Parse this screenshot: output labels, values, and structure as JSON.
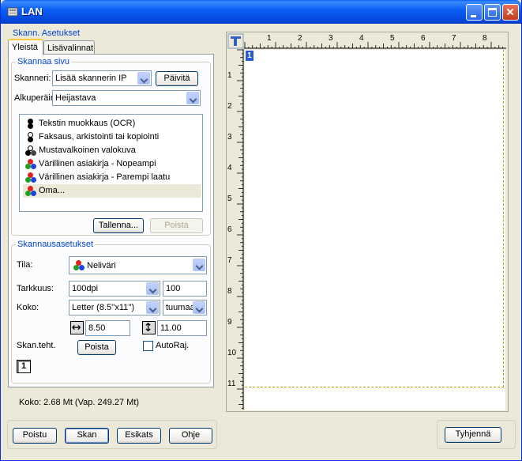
{
  "window": {
    "title": "LAN"
  },
  "settings_group": {
    "legend": "Skann. Asetukset"
  },
  "tabs": [
    {
      "label": "Yleistä"
    },
    {
      "label": "Lisävalinnat"
    }
  ],
  "scan_page": {
    "legend": "Skannaa sivu",
    "scanner_label": "Skanneri:",
    "scanner_value": "Lisää skannerin IP",
    "refresh_button": "Päivitä",
    "source_label": "Alkuperäin",
    "source_value": "Heijastava",
    "presets": [
      {
        "label": "Tekstin muokkaus (OCR)",
        "icon": "bw-dots-icon"
      },
      {
        "label": "Faksaus, arkistointi tai kopiointi",
        "icon": "bw-dots-icon"
      },
      {
        "label": "Mustavalkoinen valokuva",
        "icon": "gray-dots-icon"
      },
      {
        "label": "Värillinen asiakirja - Nopeampi",
        "icon": "color-dots-icon"
      },
      {
        "label": "Värillinen asiakirja - Parempi laatu",
        "icon": "color-dots-icon"
      },
      {
        "label": "Oma...",
        "icon": "color-dots-icon",
        "selected": true
      }
    ],
    "save_button": "Tallenna...",
    "delete_button": "Poista"
  },
  "scan_settings": {
    "legend": "Skannausasetukset",
    "mode_label": "Tila:",
    "mode_value": "Neliväri",
    "resolution_label": "Tarkkuus:",
    "resolution_value": "100dpi",
    "resolution_number": "100",
    "size_label": "Koko:",
    "size_value": "Letter (8.5''x11'')",
    "unit_value": "tuumaa",
    "width_value": "8.50",
    "height_value": "11.00",
    "scan_area_label": "Skan.teht.",
    "scan_area_delete": "Poista",
    "autocrop_label": "AutoRaj.",
    "page_count": "1"
  },
  "status": {
    "size_text": "Koko: 2.68 Mt (Vap. 249.27 Mt)"
  },
  "bottom_buttons": {
    "exit": "Poistu",
    "scan": "Skan",
    "preview": "Esikats",
    "help": "Ohje",
    "clear": "Tyhjennä"
  },
  "preview": {
    "page_marker": "1",
    "ruler_top": [
      "1",
      "2",
      "3",
      "4",
      "5",
      "6",
      "7",
      "8"
    ],
    "ruler_left": [
      "1",
      "2",
      "3",
      "4",
      "5",
      "6",
      "7",
      "8",
      "9",
      "10",
      "11"
    ]
  },
  "colors": {
    "title_bar": "#0a5ff7",
    "accent_label": "#0046d5",
    "scan_border": "#b0a400"
  }
}
